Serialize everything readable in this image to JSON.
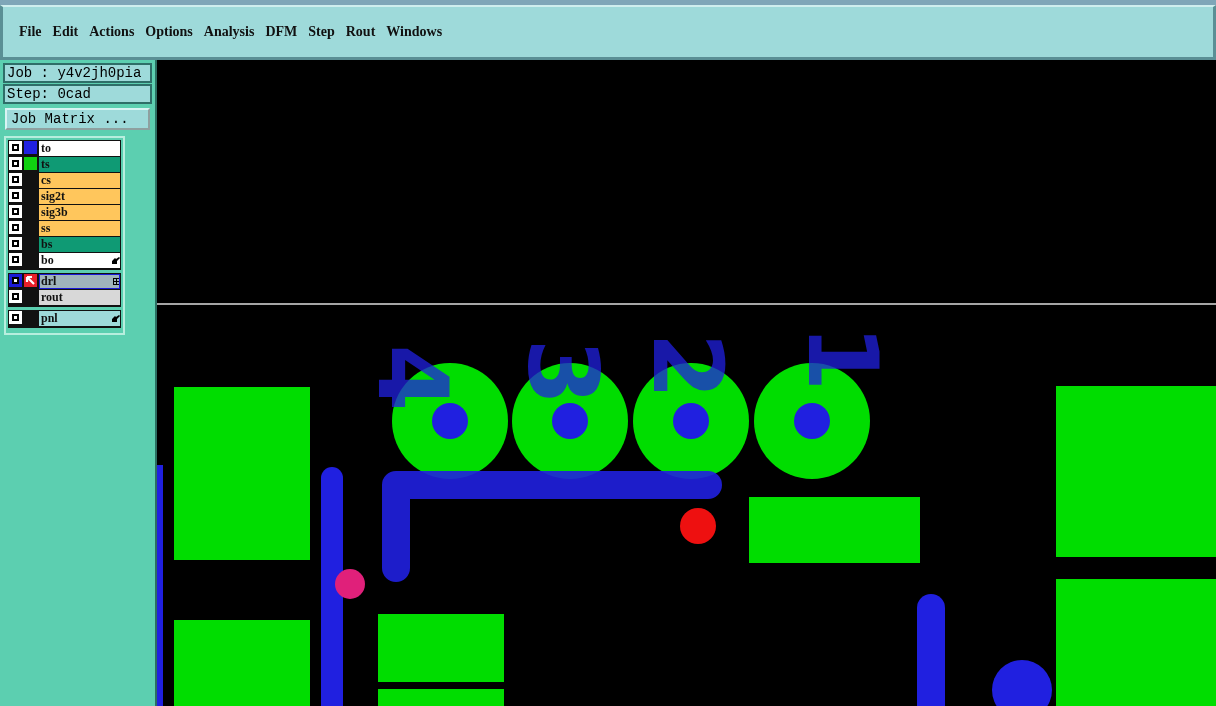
{
  "menu": [
    "File",
    "Edit",
    "Actions",
    "Options",
    "Analysis",
    "DFM",
    "Step",
    "Rout",
    "Windows"
  ],
  "job": {
    "job_label": "Job : y4v2jh0pia",
    "step_label": "Step: 0cad",
    "matrix_button": "Job Matrix ..."
  },
  "layer_groups": [
    {
      "layers": [
        {
          "name": "to",
          "kind": "plain",
          "checked": true,
          "selected": false,
          "color": "#ffffff",
          "swatch": {
            "color": "#2020e0"
          }
        },
        {
          "name": "ts",
          "kind": "plain",
          "checked": true,
          "selected": false,
          "color": "#0f9a74",
          "swatch": {
            "color": "#10d010"
          }
        },
        {
          "name": "cs",
          "kind": "plain",
          "checked": true,
          "selected": false,
          "color": "#ffc65c"
        },
        {
          "name": "sig2t",
          "kind": "plain",
          "checked": true,
          "selected": false,
          "color": "#ffc65c"
        },
        {
          "name": "sig3b",
          "kind": "plain",
          "checked": true,
          "selected": false,
          "color": "#ffc65c"
        },
        {
          "name": "ss",
          "kind": "plain",
          "checked": true,
          "selected": false,
          "color": "#ffc65c"
        },
        {
          "name": "bs",
          "kind": "plain",
          "checked": true,
          "selected": false,
          "color": "#0f9a74"
        },
        {
          "name": "bo",
          "kind": "hand",
          "checked": true,
          "selected": false,
          "color": "#ffffff"
        }
      ]
    },
    {
      "layers": [
        {
          "name": "drl",
          "kind": "drill",
          "checked": true,
          "selected": true,
          "color": "#9fb4bc"
        },
        {
          "name": "rout",
          "kind": "plain",
          "checked": true,
          "selected": false,
          "color": "#d8d8d8"
        }
      ]
    },
    {
      "layers": [
        {
          "name": "pnl",
          "kind": "hand",
          "checked": true,
          "selected": false,
          "color": "#9edada"
        }
      ]
    }
  ],
  "silkscreen_labels": [
    "4",
    "3",
    "2",
    "1"
  ]
}
